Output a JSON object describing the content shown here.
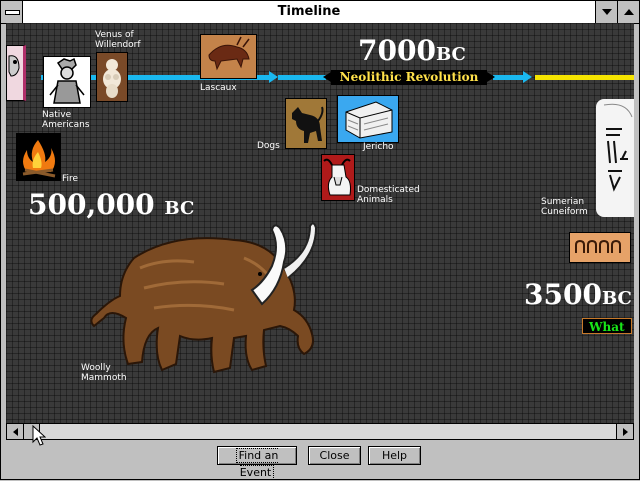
{
  "window": {
    "title": "Timeline"
  },
  "timeline": {
    "events": {
      "venus": "Venus of\nWillendorf",
      "native": "Native\nAmericans",
      "lascaux": "Lascaux",
      "fire": "Fire",
      "dogs": "Dogs",
      "jericho": "Jericho",
      "animals": "Domesticated\nAnimals",
      "mammoth": "Woolly\nMammoth",
      "sumerian": "Sumerian\nCuneiform"
    },
    "dates": {
      "d7000_num": "7000",
      "d7000_suffix": "BC",
      "d500k_num": "500,000",
      "d500k_suffix": "BC",
      "d3500_num": "3500",
      "d3500_suffix": "BC"
    },
    "era_label": "Neolithic Revolution",
    "next_label": "What"
  },
  "buttons": {
    "find": "Find an Event",
    "close": "Close",
    "help": "Help"
  },
  "icons": [
    "system-menu-icon",
    "minimize-icon",
    "maximize-icon",
    "scroll-left-icon",
    "scroll-right-icon",
    "mouse-cursor-icon"
  ],
  "colors": {
    "timeline_arrow": "#1ab8ef",
    "era_text": "#ffe14a",
    "what_text": "#19e619",
    "canvas_bg": "#3a3a3a"
  }
}
